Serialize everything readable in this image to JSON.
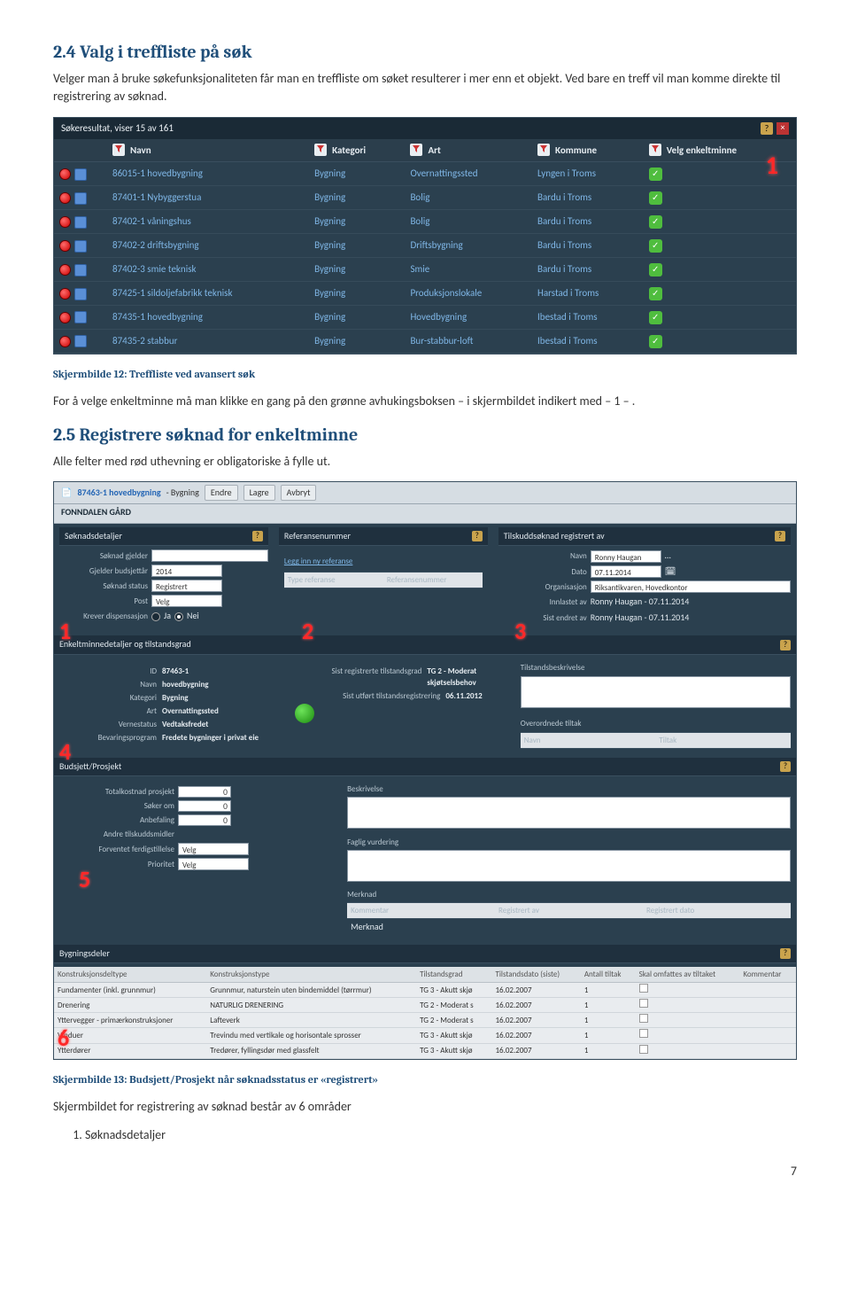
{
  "h_24": "2.4   Valg i treffliste på søk",
  "p_intro": "Velger man å bruke søkefunksjonaliteten får man en treffliste om søket resulterer i mer enn et objekt. Ved bare en treff vil man komme direkte til registrering av søknad.",
  "panel_title": "Søkeresultat, viser 15 av 161",
  "columns": [
    "Navn",
    "Kategori",
    "Art",
    "Kommune",
    "Velg enkeltminne"
  ],
  "rows": [
    {
      "navn": "86015-1 hovedbygning",
      "kat": "Bygning",
      "art": "Overnattingssted",
      "kom": "Lyngen i Troms"
    },
    {
      "navn": "87401-1 Nybyggerstua",
      "kat": "Bygning",
      "art": "Bolig",
      "kom": "Bardu i Troms"
    },
    {
      "navn": "87402-1 våningshus",
      "kat": "Bygning",
      "art": "Bolig",
      "kom": "Bardu i Troms"
    },
    {
      "navn": "87402-2 driftsbygning",
      "kat": "Bygning",
      "art": "Driftsbygning",
      "kom": "Bardu i Troms"
    },
    {
      "navn": "87402-3 smie teknisk",
      "kat": "Bygning",
      "art": "Smie",
      "kom": "Bardu i Troms"
    },
    {
      "navn": "87425-1 sildoljefabrikk teknisk",
      "kat": "Bygning",
      "art": "Produksjonslokale",
      "kom": "Harstad i Troms"
    },
    {
      "navn": "87435-1 hovedbygning",
      "kat": "Bygning",
      "art": "Hovedbygning",
      "kom": "Ibestad i Troms"
    },
    {
      "navn": "87435-2 stabbur",
      "kat": "Bygning",
      "art": "Bur-stabbur-loft",
      "kom": "Ibestad i Troms"
    }
  ],
  "anno1": "1",
  "cap12": "Skjermbilde 12: Treffliste ved avansert søk",
  "p_for": "For å velge enkeltminne må man klikke en gang på den grønne avhukingsboksen – i skjermbildet indikert med – 1 – .",
  "h_25": "2.5   Registrere søknad for enkeltminne",
  "p_alle": "Alle felter med rød uthevning er obligatoriske å fylle ut.",
  "app": {
    "title_link": "87463-1 hovedbygning",
    "title_dash": " - Bygning",
    "subtitle": "FONNDALEN GÅRD",
    "btn_endre": "Endre",
    "btn_lagre": "Lagre",
    "btn_avbryt": "Avbryt",
    "sec1": {
      "head": "Søknadsdetaljer",
      "f1": "Søknad gjelder",
      "f2": "Gjelder budsjettår",
      "v2": "2014",
      "f3": "Søknad status",
      "v3": "Registrert",
      "f4": "Post",
      "v4": "Velg",
      "f5": "Krever dispensasjon",
      "ja": "Ja",
      "nei": "Nei"
    },
    "sec2": {
      "head": "Referansenummer",
      "add": "Legg inn ny referanse",
      "h1": "Type referanse",
      "h2": "Referansenummer"
    },
    "sec3": {
      "head": "Tilskuddsøknad registrert av",
      "navn": "Navn",
      "navn_v": "Ronny Haugan",
      "dato": "Dato",
      "dato_v": "07.11.2014",
      "org": "Organisasjon",
      "org_v": "Riksantikvaren, Hovedkontor",
      "inn": "Innlastet av",
      "inn_v": "Ronny Haugan - 07.11.2014",
      "sist": "Sist endret av",
      "sist_v": "Ronny Haugan - 07.11.2014"
    },
    "sec4": {
      "head": "Enkeltminnedetaljer og tilstandsgrad",
      "id": "ID",
      "id_v": "87463-1",
      "navn": "Navn",
      "navn_v": "hovedbygning",
      "kat": "Kategori",
      "kat_v": "Bygning",
      "art": "Art",
      "art_v": "Overnattingssted",
      "vern": "Vernestatus",
      "vern_v": "Vedtaksfredet",
      "bev": "Bevaringsprogram",
      "bev_v": "Fredete bygninger i privat eie",
      "r1": "Sist registrerte tilstandsgrad",
      "r1v": "TG 2 - Moderat skjøtselsbehov",
      "r2": "Sist utført tilstandsregistrering",
      "r2v": "06.11.2012",
      "tb": "Tilstandsbeskrivelse",
      "ot": "Overordnede tiltak",
      "oth1": "Navn",
      "oth2": "Tiltak"
    },
    "sec5": {
      "head": "Budsjett/Prosjekt",
      "f1": "Totalkostnad prosjekt",
      "v1": "0",
      "f2": "Søker om",
      "v2": "0",
      "f3": "Anbefaling",
      "v3": "0",
      "f4": "Andre tilskuddsmidler",
      "f5": "Forventet ferdigstillelse",
      "v5": "Velg",
      "f6": "Prioritet",
      "v6": "Velg",
      "be": "Beskrivelse",
      "fv": "Faglig vurdering",
      "mk": "Merknad",
      "tbl": [
        "Kommentar",
        "Registrert av",
        "Registrert dato"
      ],
      "mk2": "Merknad"
    },
    "sec6": {
      "head": "Bygningsdeler",
      "cols": [
        "Konstruksjonsdeltype",
        "Konstruksjonstype",
        "Tilstandsgrad",
        "Tilstandsdato (siste)",
        "Antall tiltak",
        "Skal omfattes av tiltaket",
        "Kommentar"
      ],
      "rows": [
        {
          "a": "Fundamenter (inkl. grunnmur)",
          "b": "Grunnmur, naturstein uten bindemiddel (tørrmur)",
          "c": "TG 3 - Akutt skjø",
          "d": "16.02.2007",
          "e": "1"
        },
        {
          "a": "Drenering",
          "b": "NATURLIG DRENERING",
          "c": "TG 2 - Moderat s",
          "d": "16.02.2007",
          "e": "1"
        },
        {
          "a": "Yttervegger - primærkonstruksjoner",
          "b": "Lafteverk",
          "c": "TG 2 - Moderat s",
          "d": "16.02.2007",
          "e": "1"
        },
        {
          "a": "Vinduer",
          "b": "Trevindu med vertikale og horisontale sprosser",
          "c": "TG 3 - Akutt skjø",
          "d": "16.02.2007",
          "e": "1"
        },
        {
          "a": "Ytterdører",
          "b": "Tredører, fyllingsdør med glassfelt",
          "c": "TG 3 - Akutt skjø",
          "d": "16.02.2007",
          "e": "1"
        }
      ]
    }
  },
  "ann": {
    "1": "1",
    "2": "2",
    "3": "3",
    "4": "4",
    "5": "5",
    "6": "6"
  },
  "cap13": "Skjermbilde 13: Budsjett/Prosjekt når søknadsstatus er «registrert»",
  "p_end": "Skjermbildet for registrering av søknad består av 6 områder",
  "li1": "Søknadsdetaljer",
  "pagenum": "7"
}
